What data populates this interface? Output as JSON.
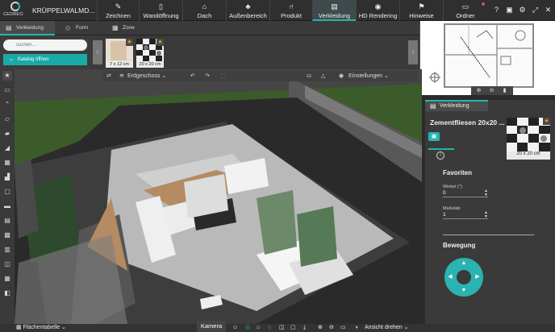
{
  "app": {
    "logo_text": "CEDREO",
    "project_name": "KRÜPPELWALMD..."
  },
  "toolbar": {
    "items": [
      {
        "label": "Zeichnen",
        "icon": "pencil-icon"
      },
      {
        "label": "Wandöffnung",
        "icon": "door-icon"
      },
      {
        "label": "Dach",
        "icon": "roof-icon"
      },
      {
        "label": "Außenbereich",
        "icon": "tree-icon"
      },
      {
        "label": "Produkt",
        "icon": "chair-icon"
      },
      {
        "label": "Verkleidung",
        "icon": "paint-roller-icon"
      },
      {
        "label": "HD Rendering",
        "icon": "camera-icon"
      },
      {
        "label": "Hinweise",
        "icon": "pin-icon"
      },
      {
        "label": "Ordner",
        "icon": "folder-icon"
      }
    ],
    "active": "Verkleidung"
  },
  "subtabs": {
    "items": [
      {
        "label": "Verkleidung",
        "icon": "paint-roller-icon"
      },
      {
        "label": "Form",
        "icon": "shape-icon"
      },
      {
        "label": "Zone",
        "icon": "zone-icon"
      }
    ]
  },
  "catalog": {
    "search_placeholder": "suchen...",
    "open_label": "Katalog öffnen"
  },
  "materials": [
    {
      "caption": "7 x 12 cm"
    },
    {
      "caption": "20 x 20 cm"
    }
  ],
  "view_toolbar": {
    "floor": "Erdgeschoss",
    "settings": "Einstellungen"
  },
  "right_panel": {
    "tab_label": "Verkleidung",
    "material_name": "Zementfliesen 20x20 ...",
    "thumb_caption": "20 x 20 cm",
    "favorites_title": "Favoriten",
    "angle_label": "Winkel (°)",
    "angle_value": "0",
    "scale_label": "Maßstab",
    "scale_value": "1",
    "movement_title": "Bewegung"
  },
  "bottom": {
    "area_table": "Flächentabelle",
    "camera": "Kamera",
    "rotate_view": "Ansicht drehen"
  },
  "colors": {
    "accent": "#26b3b0",
    "notification": "#e8359c",
    "star": "#f39c12"
  }
}
